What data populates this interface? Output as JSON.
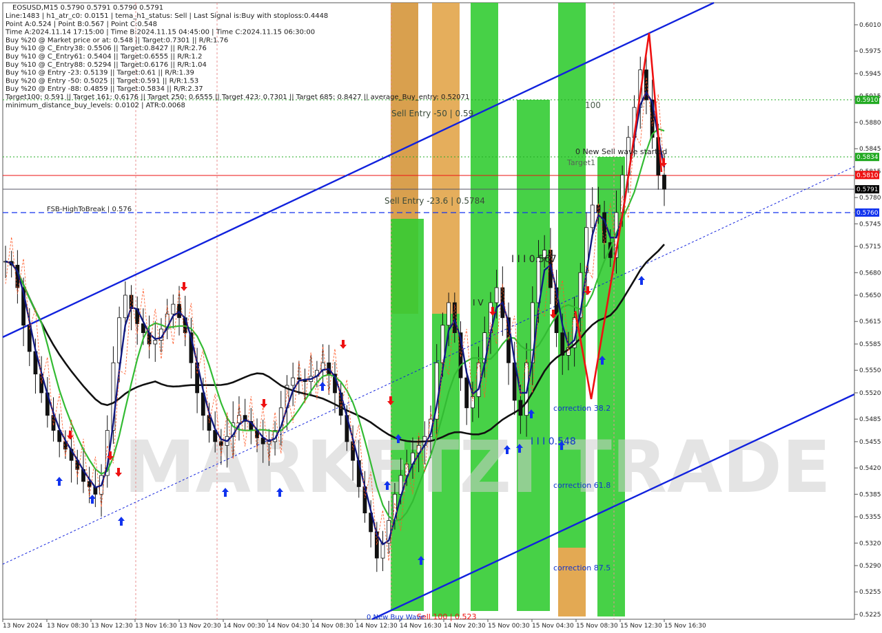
{
  "chart_data": {
    "type": "line",
    "symbol_header": "EOSUSD,M15  0.5790 0.5791 0.5790 0.5791",
    "info_lines": [
      "Line:1483 | h1_atr_c0: 0.0151 | tema_h1_status: Sell | Last Signal is:Buy with stoploss:0.4448",
      "Point A:0.524 | Point B:0.567 | Point C:0.548",
      "Time A:2024.11.14 17:15:00 | Time B:2024.11.15 04:45:00 | Time C:2024.11.15 06:30:00",
      "Buy %20 @ Market price or at: 0.548 || Target:0.7301 || R/R:1.76",
      "Buy %10 @ C_Entry38: 0.5506 || Target:0.8427 || R/R:2.76",
      "Buy %10 @ C_Entry61: 0.5404 || Target:0.6555 || R/R:1.2",
      "Buy %10 @ C_Entry88: 0.5294 || Target:0.6176 || R/R:1.04",
      "Buy %10 @ Entry -23: 0.5139 || Target:0.61 || R/R:1.39",
      "Buy %20 @ Entry -50: 0.5025 || Target:0.591 || R/R:1.53",
      "Buy %20 @ Entry -88: 0.4859 || Target:0.5834 || R/R:2.37",
      "Target100: 0.591 || Target 161: 0.6176 || Target 250: 0.6555 || Target 423: 0.7301 || Target 685: 0.8427 || average_Buy_entry: 0.52071",
      "minimum_distance_buy_levels: 0.0102 | ATR:0.0068"
    ],
    "y_ticks": [
      "0.6010",
      "0.5975",
      "0.5945",
      "0.5915",
      "0.5880",
      "0.5845",
      "0.5815",
      "0.5780",
      "0.5745",
      "0.5715",
      "0.5680",
      "0.5650",
      "0.5615",
      "0.5585",
      "0.5550",
      "0.5520",
      "0.5485",
      "0.5455",
      "0.5420",
      "0.5385",
      "0.5355",
      "0.5320",
      "0.5290",
      "0.5255",
      "0.5225"
    ],
    "x_ticks": [
      "13 Nov 2024",
      "13 Nov 08:30",
      "13 Nov 12:30",
      "13 Nov 16:30",
      "13 Nov 20:30",
      "14 Nov 00:30",
      "14 Nov 04:30",
      "14 Nov 08:30",
      "14 Nov 12:30",
      "14 Nov 16:30",
      "14 Nov 20:30",
      "15 Nov 00:30",
      "15 Nov 04:30",
      "15 Nov 08:30",
      "15 Nov 12:30",
      "15 Nov 16:30"
    ],
    "ylim": [
      0.5215,
      0.6035
    ],
    "price_tags": [
      {
        "value": 0.591,
        "label": "0.5910",
        "color": "#22aa22"
      },
      {
        "value": 0.5834,
        "label": "0.5834",
        "color": "#22aa22"
      },
      {
        "value": 0.581,
        "label": "0.5810",
        "color": "#ee1111"
      },
      {
        "value": 0.5791,
        "label": "0.5791",
        "color": "#000000"
      },
      {
        "value": 0.576,
        "label": "0.5760",
        "color": "#1133ee"
      }
    ],
    "annotations": {
      "sell_entry_50": "Sell Entry -50 | 0.59",
      "sell_entry_236": "Sell Entry -23.6 | 0.5784",
      "fsb": "FSB-HighToBreak | 0.576",
      "label_100": "100",
      "new_sell_wave": "0 New Sell wave started",
      "target1": "Target1",
      "point_b": "I I I 0.567",
      "point_c": "I I I 0.548",
      "point_iv": "I V",
      "corr_382": "correction 38.2",
      "corr_618": "correction 61.8",
      "corr_875": "correction 87.5",
      "sell_100": "Sell 100 | 0.523",
      "new_buy": "0 New Buy Wave"
    },
    "watermark": "MARKETZI TRADE",
    "close_series": [
      0.5695,
      0.569,
      0.566,
      0.561,
      0.5575,
      0.5545,
      0.552,
      0.549,
      0.547,
      0.5455,
      0.5445,
      0.543,
      0.5418,
      0.5402,
      0.5395,
      0.5385,
      0.541,
      0.547,
      0.556,
      0.562,
      0.565,
      0.5632,
      0.5612,
      0.56,
      0.5585,
      0.559,
      0.5605,
      0.5625,
      0.5638,
      0.562,
      0.56,
      0.556,
      0.552,
      0.549,
      0.547,
      0.5455,
      0.545,
      0.5462,
      0.548,
      0.549,
      0.5482,
      0.547,
      0.546,
      0.5452,
      0.5455,
      0.547,
      0.55,
      0.553,
      0.554,
      0.5538,
      0.5535,
      0.5542,
      0.555,
      0.556,
      0.5545,
      0.552,
      0.549,
      0.5455,
      0.543,
      0.5395,
      0.536,
      0.5335,
      0.53,
      0.532,
      0.535,
      0.5385,
      0.541,
      0.5425,
      0.544,
      0.545,
      0.5462,
      0.5485,
      0.556,
      0.561,
      0.564,
      0.56,
      0.554,
      0.55,
      0.5515,
      0.556,
      0.56,
      0.564,
      0.566,
      0.562,
      0.556,
      0.551,
      0.549,
      0.556,
      0.564,
      0.57,
      0.571,
      0.566,
      0.56,
      0.557,
      0.558,
      0.562,
      0.568,
      0.574,
      0.577,
      0.576,
      0.572,
      0.57,
      0.576,
      0.581,
      0.586,
      0.59,
      0.595,
      0.591,
      0.586,
      0.581,
      0.5791
    ]
  }
}
